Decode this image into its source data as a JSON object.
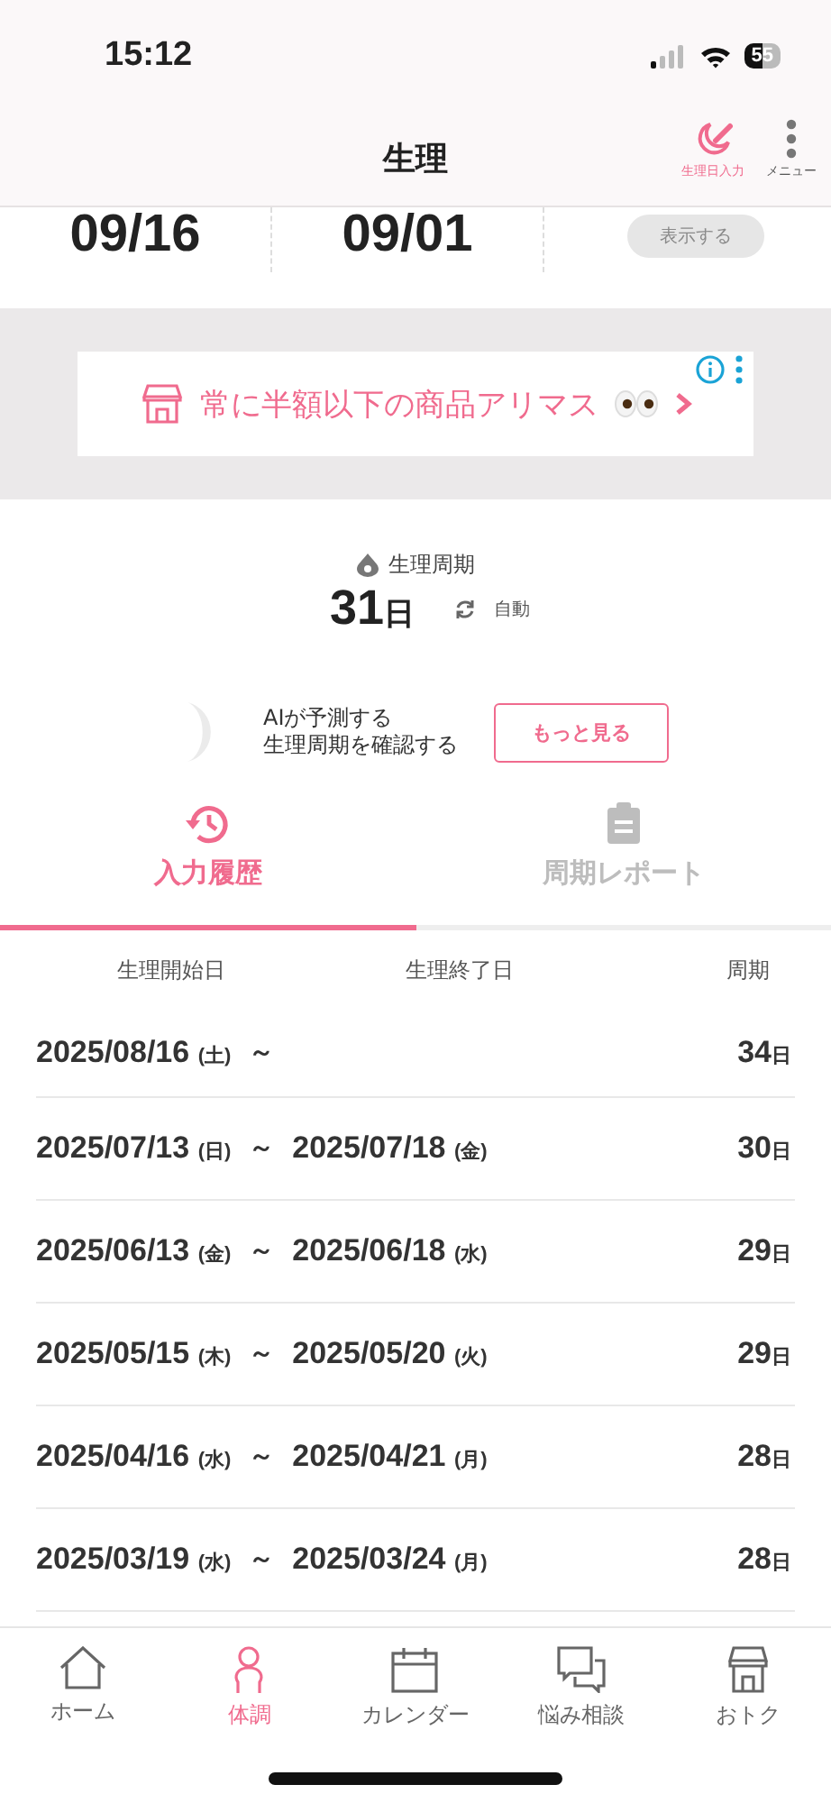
{
  "status_bar": {
    "time": "15:12",
    "battery": "55"
  },
  "header": {
    "title": "生理",
    "actions": [
      {
        "kind": "entry",
        "label": "生理日入力"
      },
      {
        "kind": "menu",
        "label": "メニュー"
      }
    ]
  },
  "dates": [
    {
      "value": "09/16"
    },
    {
      "value": "09/01"
    }
  ],
  "show_button": {
    "label": "表示する",
    "disabled": true
  },
  "ad": {
    "text": "常に半額以下の商品アリマス"
  },
  "cycle": {
    "label": "生理周期",
    "value": "31",
    "unit": "日",
    "mode": "自動"
  },
  "ai_prompt": {
    "lines": [
      "AIが予測する",
      "生理周期を確認する"
    ],
    "button": "もっと見る"
  },
  "tabs": [
    {
      "label": "入力履歴",
      "kind": "history",
      "selected": true
    },
    {
      "label": "周期レポート",
      "kind": "report",
      "selected": false
    }
  ],
  "table": {
    "columns": [
      "生理開始日",
      "生理終了日",
      "周期"
    ],
    "rows": [
      {
        "start": "2025/08/16",
        "start_day": "(土)",
        "separator": "～",
        "days": "34",
        "unit": "日"
      },
      {
        "start": "2025/07/13",
        "start_day": "(日)",
        "separator": "～",
        "end": "2025/07/18",
        "end_day": "(金)",
        "days": "30",
        "unit": "日"
      },
      {
        "start": "2025/06/13",
        "start_day": "(金)",
        "separator": "～",
        "end": "2025/06/18",
        "end_day": "(水)",
        "days": "29",
        "unit": "日"
      },
      {
        "start": "2025/05/15",
        "start_day": "(木)",
        "separator": "～",
        "end": "2025/05/20",
        "end_day": "(火)",
        "days": "29",
        "unit": "日"
      },
      {
        "start": "2025/04/16",
        "start_day": "(水)",
        "separator": "～",
        "end": "2025/04/21",
        "end_day": "(月)",
        "days": "28",
        "unit": "日"
      },
      {
        "start": "2025/03/19",
        "start_day": "(水)",
        "separator": "～",
        "end": "2025/03/24",
        "end_day": "(月)",
        "days": "28",
        "unit": "日"
      }
    ]
  },
  "nav": [
    {
      "label": "ホーム",
      "kind": "home",
      "selected": false
    },
    {
      "label": "体調",
      "kind": "body",
      "selected": true
    },
    {
      "label": "カレンダー",
      "kind": "calendar",
      "selected": false
    },
    {
      "label": "悩み相談",
      "kind": "chat",
      "selected": false
    },
    {
      "label": "おトク",
      "kind": "shop",
      "selected": false
    }
  ]
}
